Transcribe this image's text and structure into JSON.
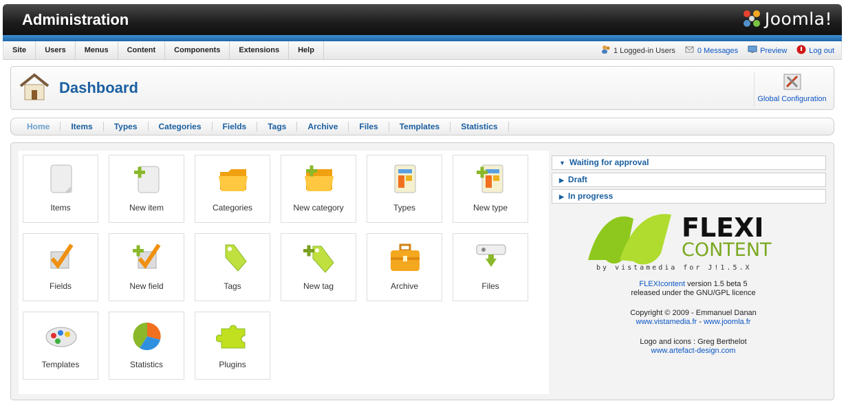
{
  "header": {
    "title": "Administration",
    "brand": "Joomla!"
  },
  "topmenu": {
    "items": [
      "Site",
      "Users",
      "Menus",
      "Content",
      "Components",
      "Extensions",
      "Help"
    ],
    "logged_in": "1 Logged-in Users",
    "messages": "0 Messages",
    "preview": "Preview",
    "logout": "Log out"
  },
  "dashboard": {
    "title": "Dashboard",
    "global_config": "Global Configuration"
  },
  "subnav": [
    "Home",
    "Items",
    "Types",
    "Categories",
    "Fields",
    "Tags",
    "Archive",
    "Files",
    "Templates",
    "Statistics"
  ],
  "icons": [
    {
      "label": "Items",
      "icon": "items-icon"
    },
    {
      "label": "New item",
      "icon": "new-item-icon"
    },
    {
      "label": "Categories",
      "icon": "folder-icon"
    },
    {
      "label": "New category",
      "icon": "new-folder-icon"
    },
    {
      "label": "Types",
      "icon": "types-icon"
    },
    {
      "label": "New type",
      "icon": "new-type-icon"
    },
    {
      "label": "Fields",
      "icon": "checkmark-icon"
    },
    {
      "label": "New field",
      "icon": "new-checkmark-icon"
    },
    {
      "label": "Tags",
      "icon": "tag-icon"
    },
    {
      "label": "New tag",
      "icon": "new-tag-icon"
    },
    {
      "label": "Archive",
      "icon": "toolbox-icon"
    },
    {
      "label": "Files",
      "icon": "download-icon"
    },
    {
      "label": "Templates",
      "icon": "palette-icon"
    },
    {
      "label": "Statistics",
      "icon": "pie-chart-icon"
    },
    {
      "label": "Plugins",
      "icon": "puzzle-icon"
    }
  ],
  "panels": {
    "waiting": "Waiting for approval",
    "draft": "Draft",
    "in_progress": "In progress"
  },
  "logo": {
    "line1": "FLEXI",
    "line2": "CONTENT",
    "tagline": "by vistamedia for J!1.5.X"
  },
  "credits": {
    "name_link": "FLEXIcontent",
    "version": " version 1.5 beta 5",
    "licence": "released under the GNU/GPL licence",
    "copyright": "Copyright © 2009 - Emmanuel Danan",
    "site1": "www.vistamedia.fr",
    "sep": " - ",
    "site2": "www.joomla.fr",
    "logo_credit": "Logo and icons : Greg Berthelot",
    "site3": "www.artefact-design.com"
  },
  "colors": {
    "accent": "#1a5fa0",
    "link": "#0b55c4",
    "header_dark": "#1c1c1c",
    "header_blue": "#2a78bc"
  }
}
